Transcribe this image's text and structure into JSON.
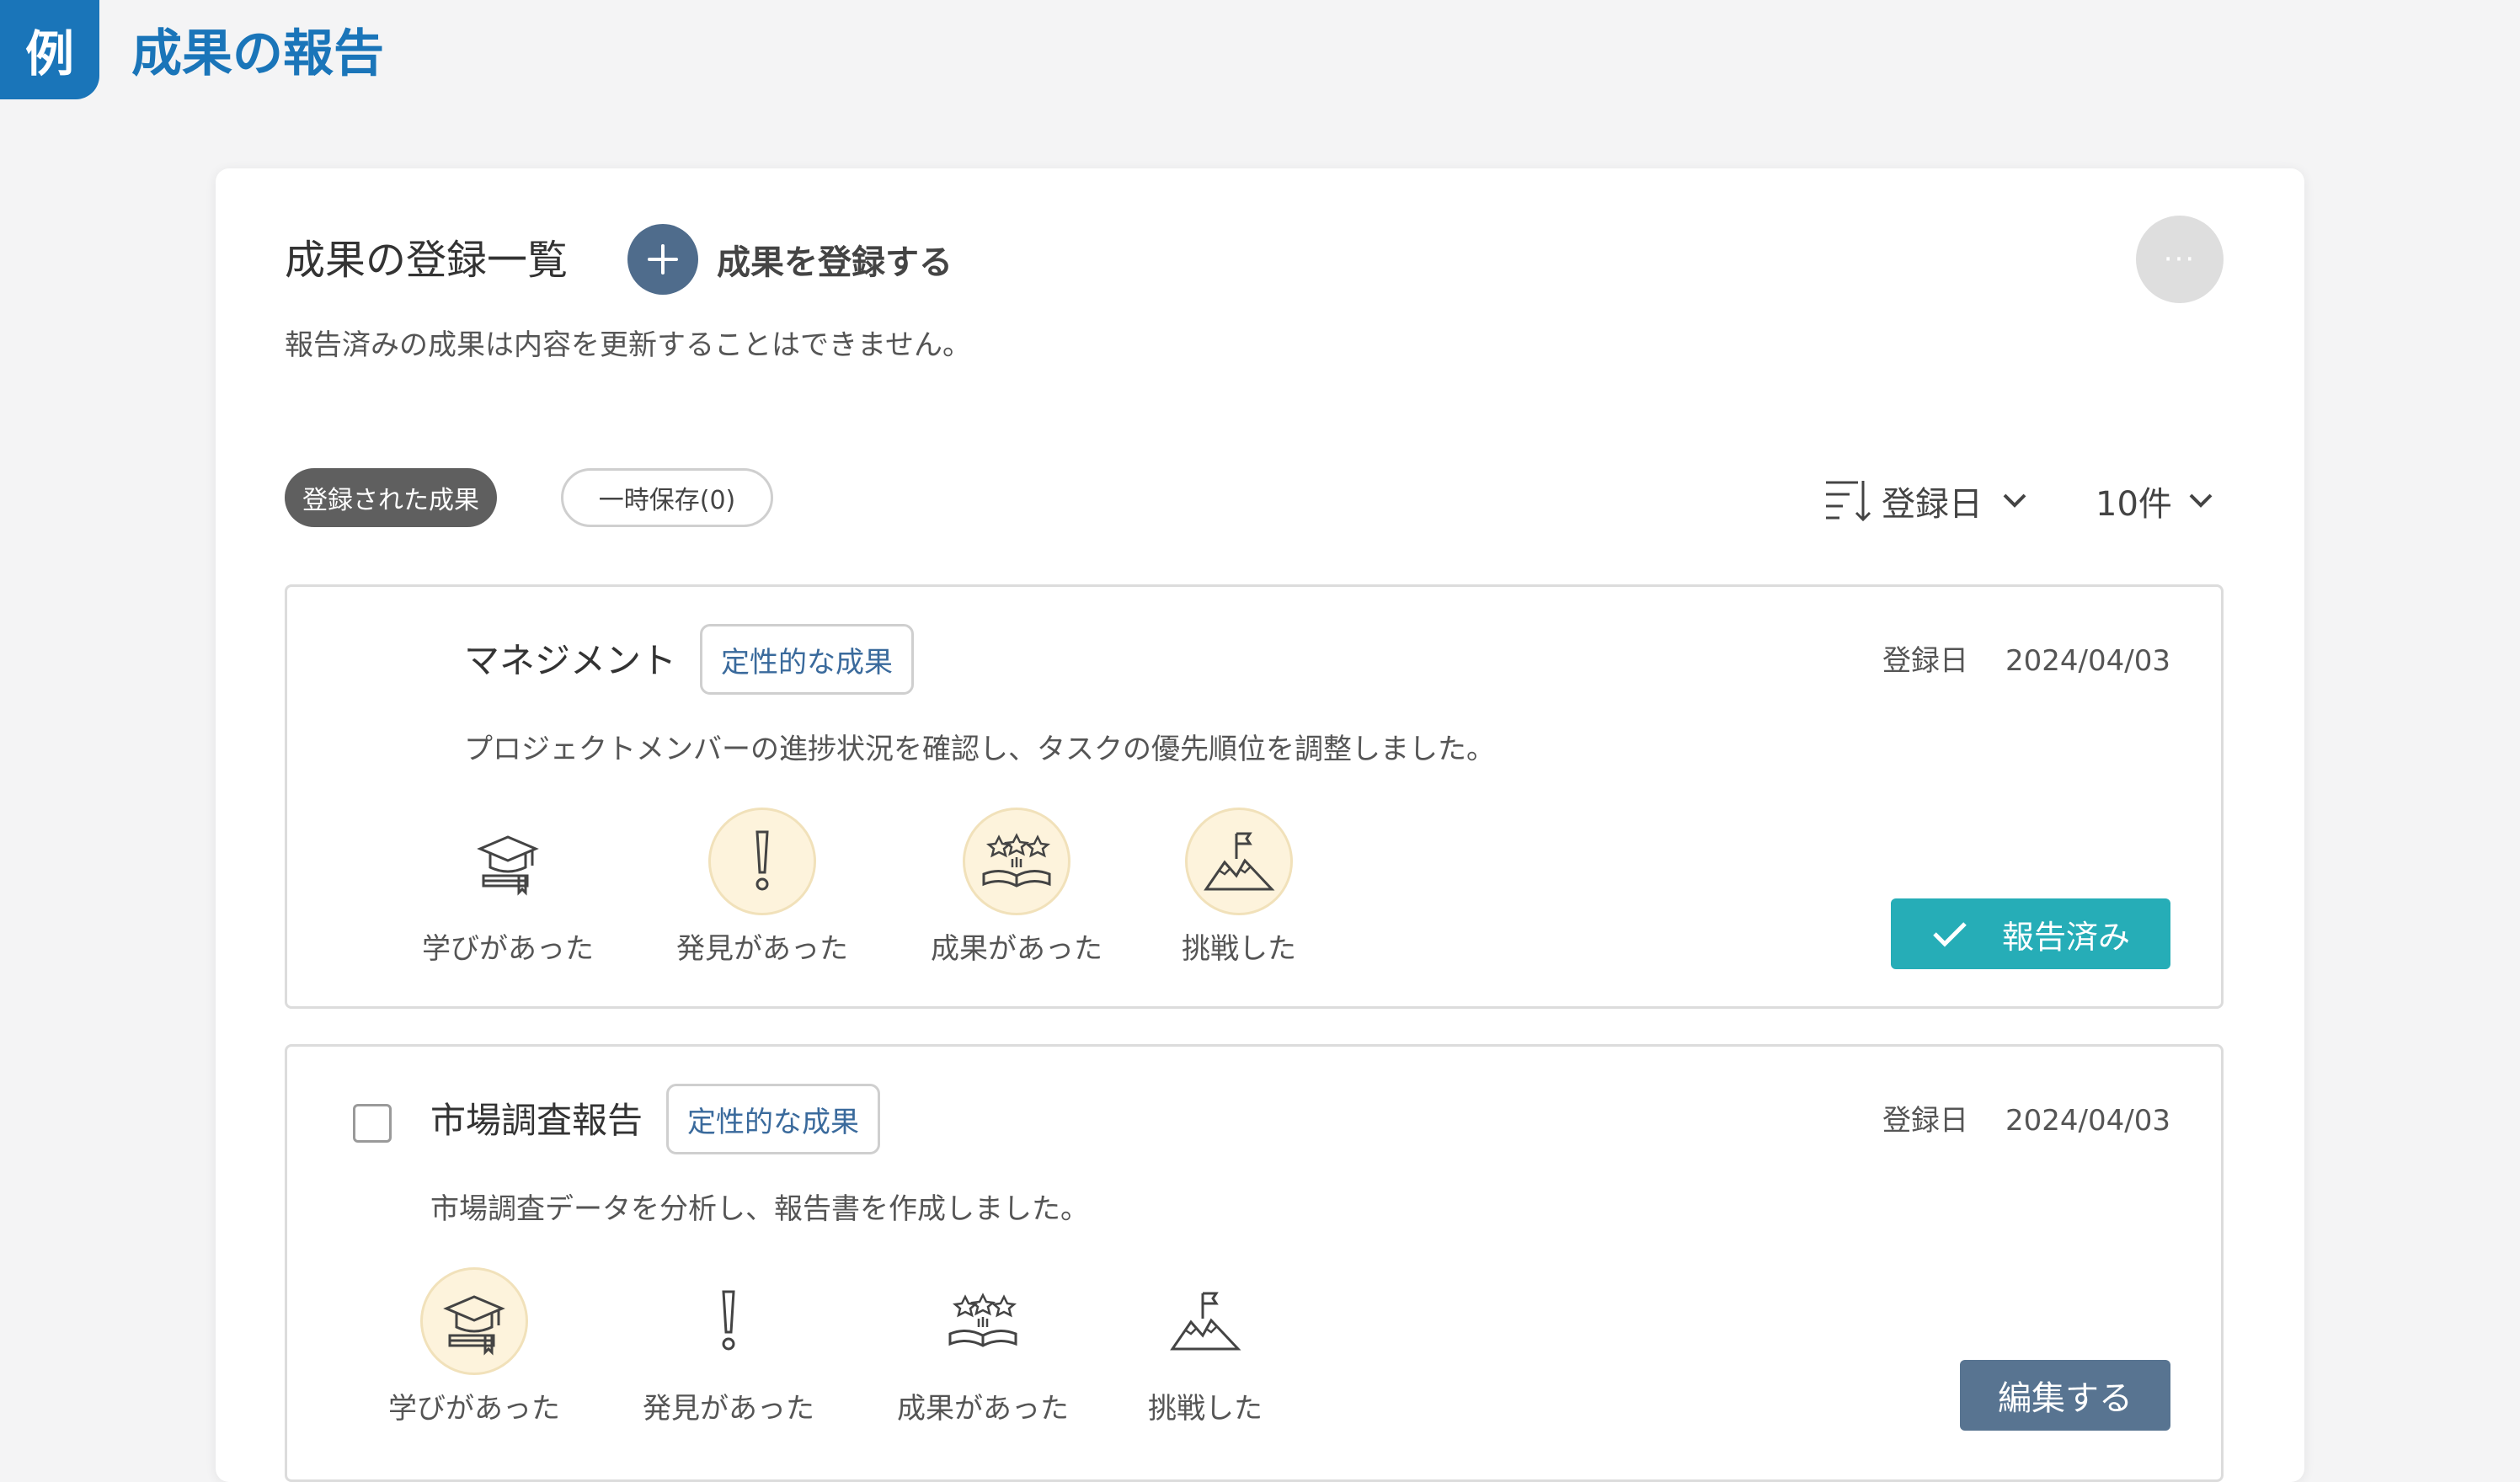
{
  "header": {
    "badge": "例",
    "title": "成果の報告"
  },
  "panel": {
    "title": "成果の登録一覧",
    "add_label": "成果を登録する",
    "more_label": "···",
    "note": "報告済みの成果は内容を更新することはできません。",
    "tabs": [
      {
        "label": "登録された成果",
        "active": true
      },
      {
        "label": "一時保存(0)",
        "active": false
      }
    ],
    "sort_label": "登録日",
    "count_label": "10件"
  },
  "reaction_labels": [
    "学びがあった",
    "発見があった",
    "成果があった",
    "挑戦した"
  ],
  "items": [
    {
      "title": "マネジメント",
      "tag": "定性的な成果",
      "date_label": "登録日",
      "date": "2024/04/03",
      "description": "プロジェクトメンバーの進捗状況を確認し、タスクの優先順位を調整しました。",
      "status_label": "報告済み",
      "reactions_active": [
        false,
        true,
        true,
        true
      ]
    },
    {
      "title": "市場調査報告",
      "tag": "定性的な成果",
      "date_label": "登録日",
      "date": "2024/04/03",
      "description": "市場調査データを分析し、報告書を作成しました。",
      "edit_label": "編集する",
      "reactions_active": [
        true,
        false,
        false,
        false
      ]
    }
  ],
  "icons": {
    "reactions": [
      "graduation-cap-icon",
      "exclamation-icon",
      "open-book-stars-icon",
      "mountain-flag-icon"
    ]
  },
  "colors": {
    "brand": "#1a75b9",
    "reported": "#26adb7",
    "edit": "#587491",
    "add_circle": "#4f6c8c",
    "highlight": "#fdf3dc"
  }
}
